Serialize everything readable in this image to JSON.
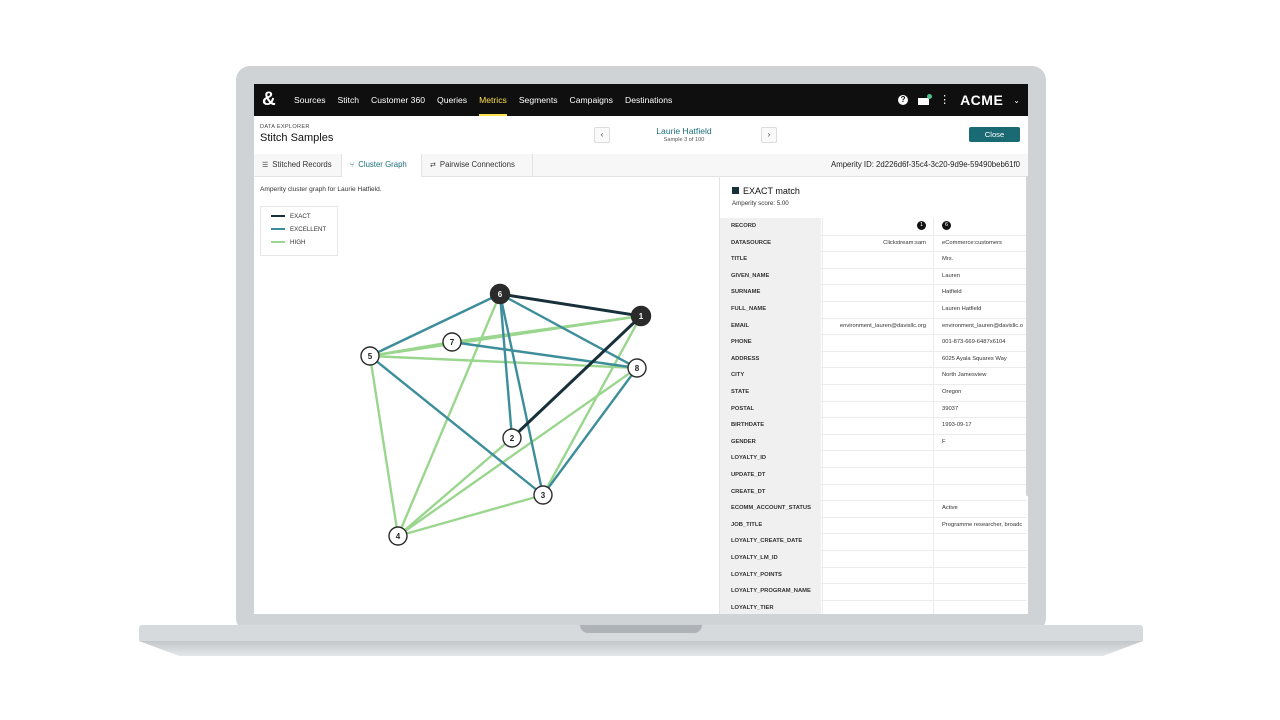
{
  "nav": {
    "logo": "&",
    "items": [
      {
        "label": "Sources",
        "active": false
      },
      {
        "label": "Stitch",
        "active": false
      },
      {
        "label": "Customer 360",
        "active": false
      },
      {
        "label": "Queries",
        "active": false
      },
      {
        "label": "Metrics",
        "active": true
      },
      {
        "label": "Segments",
        "active": false
      },
      {
        "label": "Campaigns",
        "active": false
      },
      {
        "label": "Destinations",
        "active": false
      }
    ],
    "help_icon": "?",
    "kebab_icon": "⋮",
    "brand": "ACME",
    "brand_chevron": "⌄"
  },
  "header": {
    "eyebrow": "DATA EXPLORER",
    "title": "Stitch Samples",
    "prev": "‹",
    "next": "›",
    "sample_name": "Laurie Hatfield",
    "sample_count": "Sample 3 of 100",
    "close_label": "Close"
  },
  "tabs": {
    "items": [
      {
        "label": "Stitched Records",
        "icon": "☰"
      },
      {
        "label": "Cluster Graph",
        "icon": "⑂"
      },
      {
        "label": "Pairwise Connections",
        "icon": "⇄"
      }
    ],
    "active_index": 1,
    "amperity_id": "Amperity ID: 2d226d6f-35c4-3c20-9d9e-59490beb61f0"
  },
  "graph": {
    "caption": "Amperity cluster graph for Laurie Hatfield.",
    "legend": [
      {
        "label": "EXACT",
        "color": "#17303a"
      },
      {
        "label": "EXCELLENT",
        "color": "#3d8e9a"
      },
      {
        "label": "HIGH",
        "color": "#9bd68f"
      }
    ],
    "nodes": [
      {
        "id": "6",
        "filled": true
      },
      {
        "id": "1",
        "filled": true
      },
      {
        "id": "7",
        "filled": false
      },
      {
        "id": "5",
        "filled": false
      },
      {
        "id": "8",
        "filled": false
      },
      {
        "id": "2",
        "filled": false
      },
      {
        "id": "3",
        "filled": false
      },
      {
        "id": "4",
        "filled": false
      }
    ],
    "edges": [
      {
        "from": "6",
        "to": "1",
        "type": "EXACT"
      },
      {
        "from": "2",
        "to": "1",
        "type": "EXACT"
      },
      {
        "from": "6",
        "to": "5",
        "type": "EXCELLENT"
      },
      {
        "from": "6",
        "to": "2",
        "type": "EXCELLENT"
      },
      {
        "from": "6",
        "to": "3",
        "type": "EXCELLENT"
      },
      {
        "from": "6",
        "to": "8",
        "type": "EXCELLENT"
      },
      {
        "from": "7",
        "to": "8",
        "type": "EXCELLENT"
      },
      {
        "from": "5",
        "to": "3",
        "type": "EXCELLENT"
      },
      {
        "from": "8",
        "to": "3",
        "type": "EXCELLENT"
      },
      {
        "from": "5",
        "to": "1",
        "type": "HIGH"
      },
      {
        "from": "5",
        "to": "7",
        "type": "HIGH"
      },
      {
        "from": "5",
        "to": "8",
        "type": "HIGH"
      },
      {
        "from": "5",
        "to": "4",
        "type": "HIGH"
      },
      {
        "from": "6",
        "to": "4",
        "type": "HIGH"
      },
      {
        "from": "7",
        "to": "1",
        "type": "HIGH"
      },
      {
        "from": "1",
        "to": "3",
        "type": "HIGH"
      },
      {
        "from": "8",
        "to": "4",
        "type": "HIGH"
      },
      {
        "from": "2",
        "to": "4",
        "type": "HIGH"
      },
      {
        "from": "4",
        "to": "3",
        "type": "HIGH"
      }
    ]
  },
  "match": {
    "title": "EXACT match",
    "score": "Amperity score: 5.00",
    "columns": [
      "1",
      "6"
    ],
    "rows": [
      {
        "field": "DATASOURCE",
        "a": "Clickstream:sam",
        "b": "eCommerce:customers"
      },
      {
        "field": "TITLE",
        "a": "",
        "b": "Mrs."
      },
      {
        "field": "GIVEN_NAME",
        "a": "",
        "b": "Lauren"
      },
      {
        "field": "SURNAME",
        "a": "",
        "b": "Hatfield"
      },
      {
        "field": "FULL_NAME",
        "a": "",
        "b": "Lauren Hatfield"
      },
      {
        "field": "EMAIL",
        "a": "environment_lauren@davisllc.org",
        "b": "environment_lauren@davisllc.o"
      },
      {
        "field": "PHONE",
        "a": "",
        "b": "001-873-669-6487x6104"
      },
      {
        "field": "ADDRESS",
        "a": "",
        "b": "6025 Ayala Squares Way"
      },
      {
        "field": "CITY",
        "a": "",
        "b": "North Jamesview"
      },
      {
        "field": "STATE",
        "a": "",
        "b": "Oregon"
      },
      {
        "field": "POSTAL",
        "a": "",
        "b": "39037"
      },
      {
        "field": "BIRTHDATE",
        "a": "",
        "b": "1993-09-17"
      },
      {
        "field": "GENDER",
        "a": "",
        "b": "F"
      },
      {
        "field": "LOYALTY_ID",
        "a": "",
        "b": ""
      },
      {
        "field": "UPDATE_DT",
        "a": "",
        "b": ""
      },
      {
        "field": "CREATE_DT",
        "a": "",
        "b": ""
      },
      {
        "field": "ECOMM_ACCOUNT_STATUS",
        "a": "",
        "b": "Active"
      },
      {
        "field": "JOB_TITLE",
        "a": "",
        "b": "Programme researcher, broadc"
      },
      {
        "field": "LOYALTY_CREATE_DATE",
        "a": "",
        "b": ""
      },
      {
        "field": "LOYALTY_LM_ID",
        "a": "",
        "b": ""
      },
      {
        "field": "LOYALTY_POINTS",
        "a": "",
        "b": ""
      },
      {
        "field": "LOYALTY_PROGRAM_NAME",
        "a": "",
        "b": ""
      },
      {
        "field": "LOYALTY_TIER",
        "a": "",
        "b": ""
      }
    ],
    "record_label": "RECORD"
  }
}
